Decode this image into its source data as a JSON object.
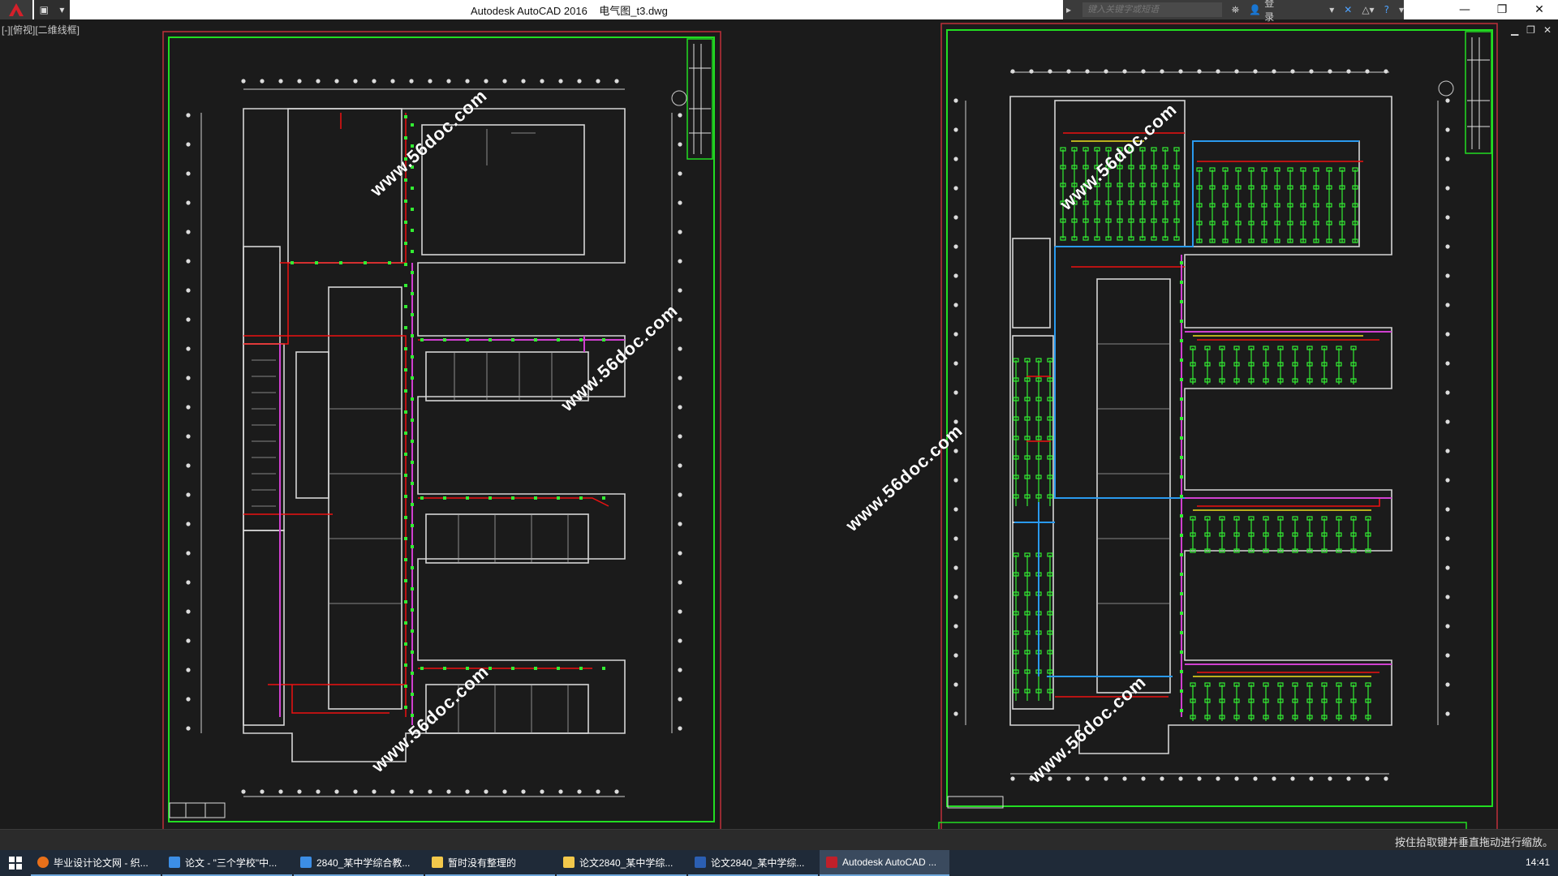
{
  "titlebar": {
    "title": "Autodesk AutoCAD 2016    电气图_t3.dwg",
    "search_placeholder": "键入关键字或短语",
    "login_label": "登录"
  },
  "viewport": {
    "label": "[-][俯视][二维线框]"
  },
  "icons": {
    "app": "autocad-logo-icon",
    "help": "help-icon",
    "binoculars": "binoculars-icon",
    "user": "user-icon"
  },
  "watermarks": {
    "text": "www.56doc.com"
  },
  "status": {
    "prompt": "按住拾取键并垂直拖动进行缩放。"
  },
  "taskbar": {
    "items": [
      {
        "label": "毕业设计论文网 - 织...",
        "icon_color": "#e8701a"
      },
      {
        "label": "论文 - \"三个学校\"中...",
        "icon_color": "#3c8ee6"
      },
      {
        "label": "2840_某中学综合教...",
        "icon_color": "#3c8ee6"
      },
      {
        "label": "暂时没有整理的",
        "icon_color": "#f2c84b"
      },
      {
        "label": "论文2840_某中学综...",
        "icon_color": "#f2c84b"
      },
      {
        "label": "论文2840_某中学综...",
        "icon_color": "#2b5fb3"
      },
      {
        "label": "Autodesk AutoCAD ...",
        "icon_color": "#c0202a"
      }
    ],
    "clock": "14:41"
  },
  "colors": {
    "sheet_border": "#c0303a",
    "frame": "#22dd22",
    "wall": "#d8d8d8",
    "red_line": "#ee1111",
    "magenta": "#d040d0",
    "green": "#33ee33",
    "blue": "#2a9aee"
  }
}
